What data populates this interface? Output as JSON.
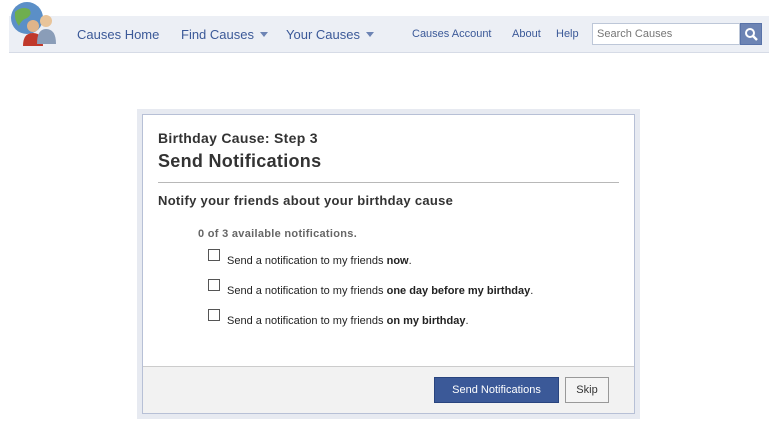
{
  "header": {
    "logo_icon": "causes-globe-people-logo",
    "nav": {
      "causes_home": "Causes Home",
      "find_causes": "Find Causes",
      "your_causes": "Your Causes",
      "causes_account": "Causes Account",
      "about": "About",
      "help": "Help"
    },
    "search": {
      "placeholder": "Search Causes",
      "icon": "magnifier-icon"
    }
  },
  "dialog": {
    "step_title": "Birthday Cause: Step 3",
    "title": "Send Notifications",
    "subheading": "Notify your friends about your birthday cause",
    "available": "0 of 3 available notifications.",
    "options": [
      {
        "prefix": "Send a notification to my friends ",
        "emphasis": "now",
        "suffix": "."
      },
      {
        "prefix": "Send a notification to my friends ",
        "emphasis": "one day before my birthday",
        "suffix": "."
      },
      {
        "prefix": "Send a notification to my friends ",
        "emphasis": "on my birthday",
        "suffix": "."
      }
    ],
    "buttons": {
      "send": "Send Notifications",
      "skip": "Skip"
    }
  },
  "colors": {
    "brand": "#3b5998",
    "nav_bg": "#eceff5"
  }
}
